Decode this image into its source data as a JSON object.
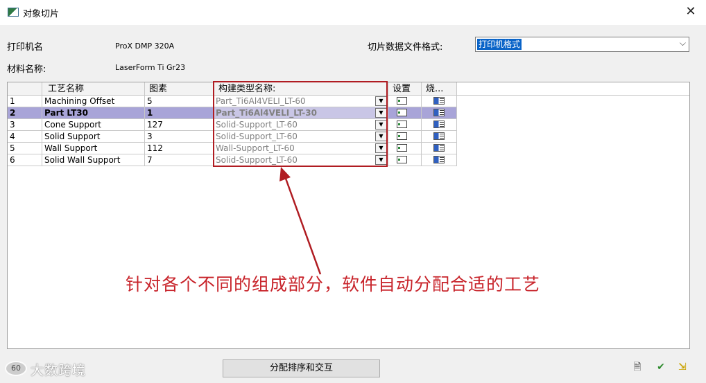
{
  "window": {
    "title": "对象切片",
    "close_glyph": "✕"
  },
  "form": {
    "printer_label": "打印机名",
    "printer_value": "ProX DMP 320A",
    "material_label": "材料名称:",
    "material_value": "LaserForm Ti Gr23",
    "slice_format_label": "切片数据文件格式:",
    "slice_format_value": "打印机格式"
  },
  "grid": {
    "columns": [
      "",
      "工艺名称",
      "图素",
      "构建类型名称:",
      "设置",
      "烧..."
    ],
    "rows": [
      {
        "num": "1",
        "name": "Machining Offset",
        "count": "5",
        "type": "Part_Ti6Al4VELI_LT-60"
      },
      {
        "num": "2",
        "name": "Part LT30",
        "count": "1",
        "type": "Part_Ti6Al4VELI_LT-30"
      },
      {
        "num": "3",
        "name": "Cone Support",
        "count": "127",
        "type": "Solid-Support_LT-60"
      },
      {
        "num": "4",
        "name": "Solid Support",
        "count": "3",
        "type": "Solid-Support_LT-60"
      },
      {
        "num": "5",
        "name": "Wall Support",
        "count": "112",
        "type": "Wall-Support_LT-60"
      },
      {
        "num": "6",
        "name": "Solid Wall Support",
        "count": "7",
        "type": "Solid-Support_LT-60"
      }
    ],
    "selected_row": "2"
  },
  "annotation": {
    "text": "针对各个不同的组成部分，软件自动分配合适的工艺",
    "color": "#c8242b"
  },
  "footer": {
    "assign_button": "分配排序和交互",
    "watermark_badge": "60",
    "watermark": "大数跨境"
  },
  "icons": {
    "window": "slice-window-icon",
    "settings": "settings-grid-icon",
    "burn": "burn-icon",
    "document": "document-icon",
    "ok": "check-icon",
    "exit": "exit-icon"
  }
}
